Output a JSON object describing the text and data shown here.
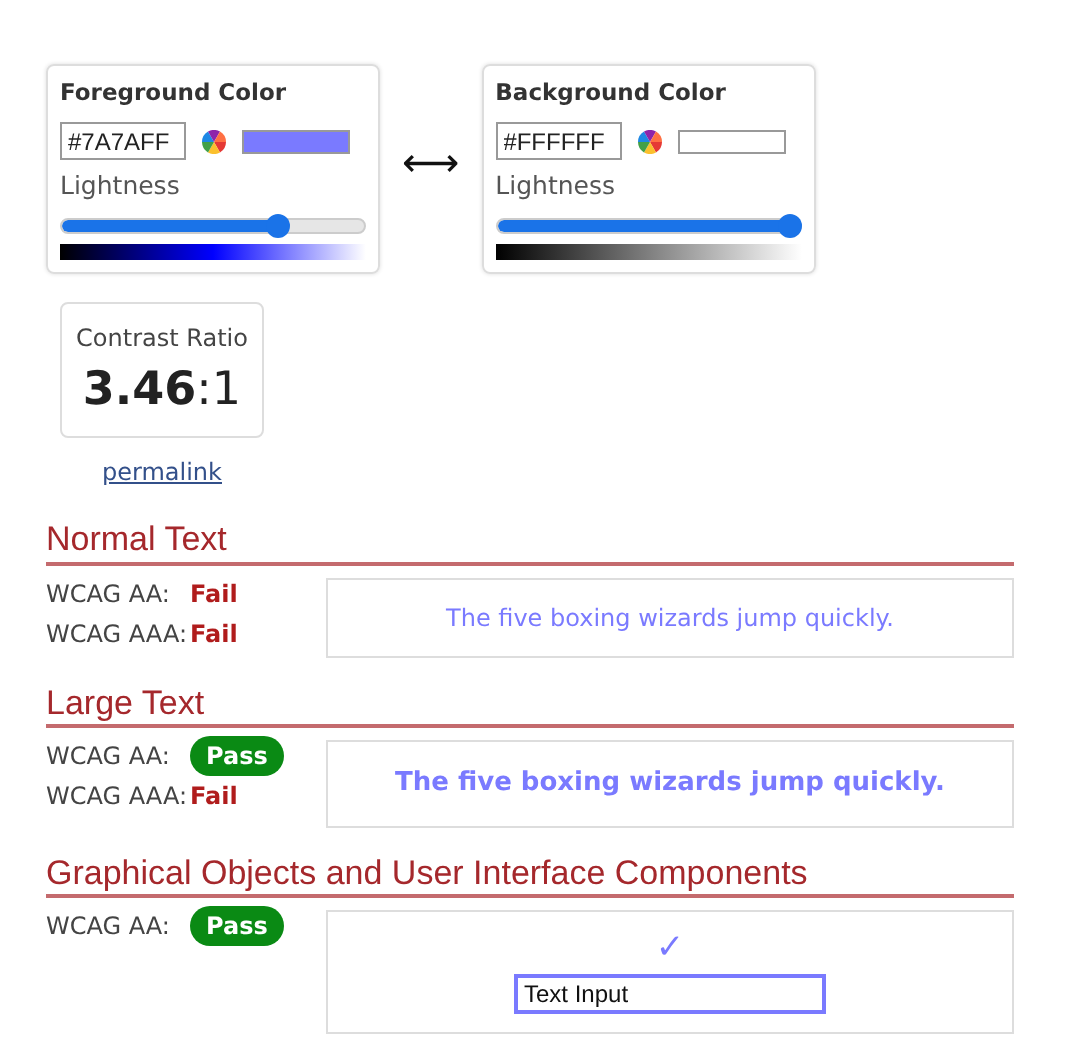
{
  "color_panels": [
    {
      "title": "Foreground Color",
      "hex": "#7A7AFF",
      "color": "#7a7aff",
      "lightness_label": "Lightness",
      "level": 0.73
    },
    {
      "title": "Background Color",
      "hex": "#FFFFFF",
      "color": "#ffffff",
      "lightness_label": "Lightness",
      "level": 1.0
    }
  ],
  "swap_symbol": "⟷",
  "contrast": {
    "label": "Contrast Ratio",
    "ratio": "3.46",
    "suffix": ":1"
  },
  "permalink": "permalink",
  "sections": [
    {
      "title": "Normal Text",
      "kind": "normal",
      "results": [
        {
          "label": "WCAG AA:",
          "result": "Fail",
          "pass": false
        },
        {
          "label": "WCAG AAA:",
          "result": "Fail",
          "pass": false
        }
      ],
      "sample": "The five boxing wizards jump quickly."
    },
    {
      "title": "Large Text",
      "kind": "large",
      "results": [
        {
          "label": "WCAG AA:",
          "result": "Pass",
          "pass": true
        },
        {
          "label": "WCAG AAA:",
          "result": "Fail",
          "pass": false
        }
      ],
      "sample": "The five boxing wizards jump quickly."
    },
    {
      "title": "Graphical Objects and User Interface Components",
      "kind": "ui",
      "results": [
        {
          "label": "WCAG AA:",
          "result": "Pass",
          "pass": true
        }
      ],
      "check": "✓",
      "input_value": "Text Input"
    }
  ]
}
